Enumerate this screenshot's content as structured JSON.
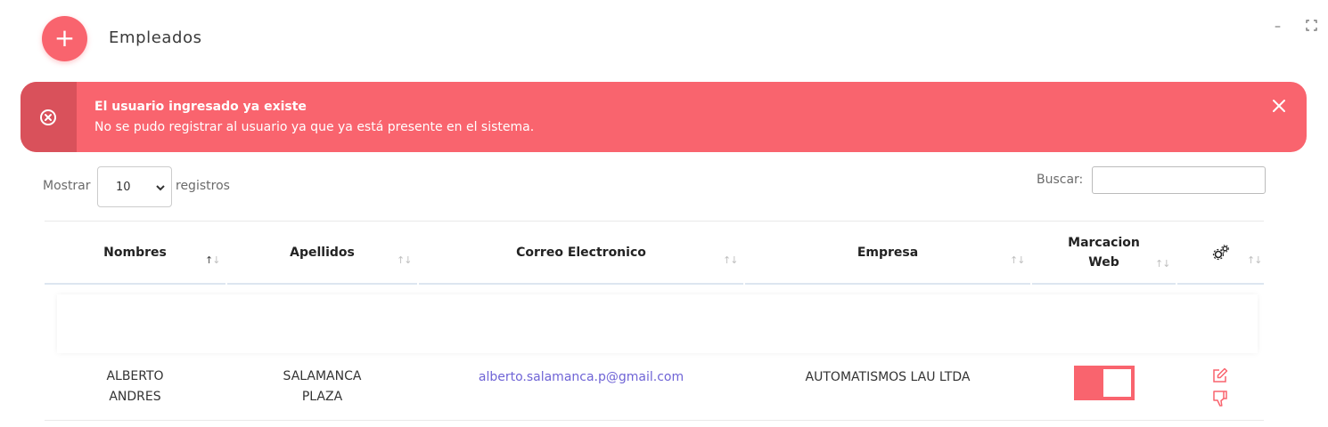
{
  "header": {
    "title": "Empleados",
    "add_symbol": "+"
  },
  "window": {
    "minimize": "–",
    "maximize": "⛶"
  },
  "alert": {
    "title": "El usuario ingresado ya existe",
    "message": "No se pudo registrar al usuario ya que ya está presente en el sistema.",
    "icon": "x-circle-icon",
    "color": "#f9646e"
  },
  "controls": {
    "show_label": "Mostrar",
    "page_length": "10",
    "show_suffix": "registros",
    "search_label": "Buscar:",
    "search_value": ""
  },
  "table": {
    "columns": [
      "Nombres",
      "Apellidos",
      "Correo Electronico",
      "Empresa",
      "Marcacion Web"
    ],
    "actions_icon": "gears-icon",
    "rows": [
      {
        "nombres": "ALBERTO ANDRES",
        "apellidos": "SALAMANCA PLAZA",
        "correo": "alberto.salamanca.p@gmail.com",
        "empresa": "AUTOMATISMOS LAU LTDA",
        "marcacion_web": true
      }
    ]
  },
  "colors": {
    "accent": "#f9646e",
    "accent_dark": "#d9515b",
    "link": "#6f64d6"
  }
}
